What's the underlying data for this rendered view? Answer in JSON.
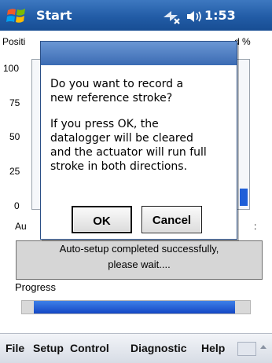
{
  "titlebar": {
    "title": "Start",
    "time": "1:53"
  },
  "background": {
    "position_label": "Positi",
    "position_label_right": "d %",
    "ticks": [
      "100",
      "75",
      "50",
      "25",
      "0"
    ],
    "auto_label_left": "Au",
    "auto_label_right": ":",
    "status_line1": "Auto-setup completed successfully,",
    "status_line2": "please wait....",
    "progress_label": "Progress",
    "progress_fraction": 0.93
  },
  "dialog": {
    "message_line1": "Do you want to record a",
    "message_line2": "new reference stroke?",
    "detail_line1": "If you press OK, the",
    "detail_line2": "datalogger will be cleared",
    "detail_line3": "and the actuator will run full",
    "detail_line4": "stroke in both directions.",
    "ok_label": "OK",
    "cancel_label": "Cancel"
  },
  "menubar": {
    "items": [
      "File",
      "Setup",
      "Control",
      "Diagnostic",
      "Help"
    ]
  }
}
